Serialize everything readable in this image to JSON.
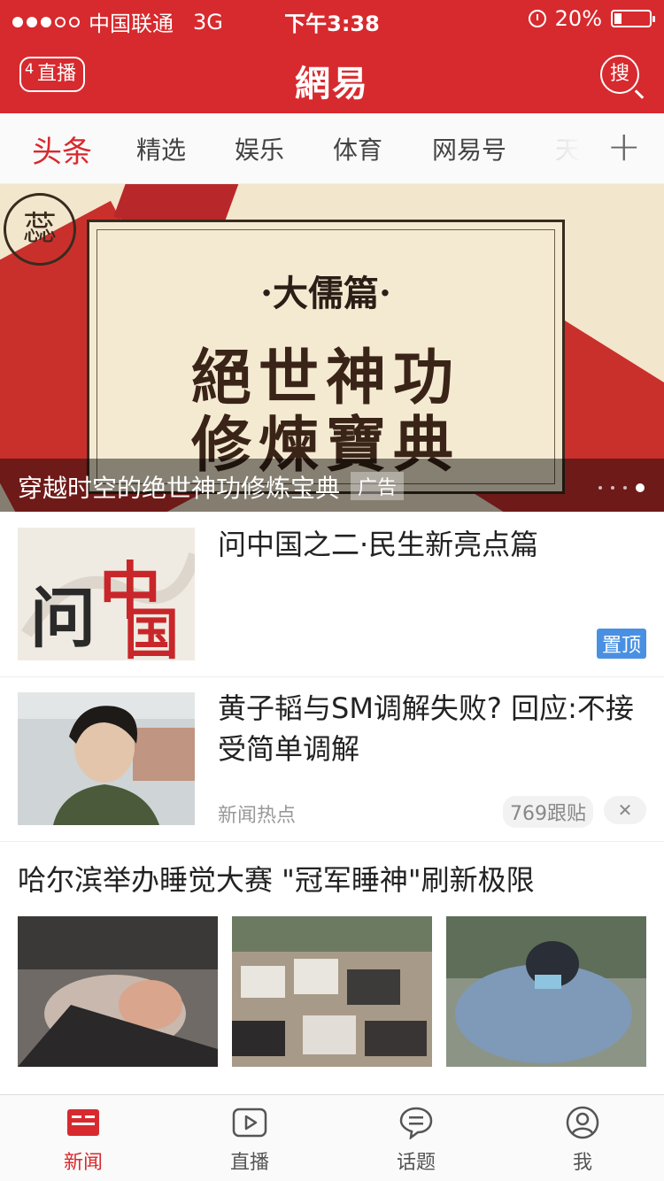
{
  "status": {
    "carrier": "中国联通",
    "network": "3G",
    "time": "下午3:38",
    "battery": "20%",
    "battery_level": 0.2,
    "signal_bars": 3
  },
  "header": {
    "live_button": "直播",
    "live_count": "4",
    "logo": "網易",
    "search_button": "搜"
  },
  "tabs": {
    "items": [
      "头条",
      "精选",
      "娱乐",
      "体育",
      "网易号",
      "天"
    ],
    "active_index": 0,
    "add_icon": "plus-icon"
  },
  "banner": {
    "seal_text": "蕊",
    "subtitle": "·大儒篇·",
    "line1": "絕世神功",
    "line2": "修煉寶典",
    "caption": "穿越时空的绝世神功修炼宝典",
    "ad_badge": "广告",
    "page_count": 4,
    "current_page": 4
  },
  "news": [
    {
      "title": "问中国之二·民生新亮点篇",
      "thumb_text": "问中国",
      "badge": "置顶"
    },
    {
      "title": "黄子韬与SM调解失败? 回应:不接受简单调解",
      "source": "新闻热点",
      "comments": "769跟贴",
      "dismiss": "✕"
    },
    {
      "title": "哈尔滨举办睡觉大赛 \"冠军睡神\"刷新极限",
      "photos": 3
    }
  ],
  "bottom_nav": {
    "items": [
      {
        "label": "新闻",
        "icon": "newspaper-icon"
      },
      {
        "label": "直播",
        "icon": "play-icon"
      },
      {
        "label": "话题",
        "icon": "speech-bubble-icon"
      },
      {
        "label": "我",
        "icon": "user-icon"
      }
    ],
    "active_index": 0
  },
  "colors": {
    "brand_red": "#d72a2e",
    "pin_blue": "#4a90e2"
  }
}
